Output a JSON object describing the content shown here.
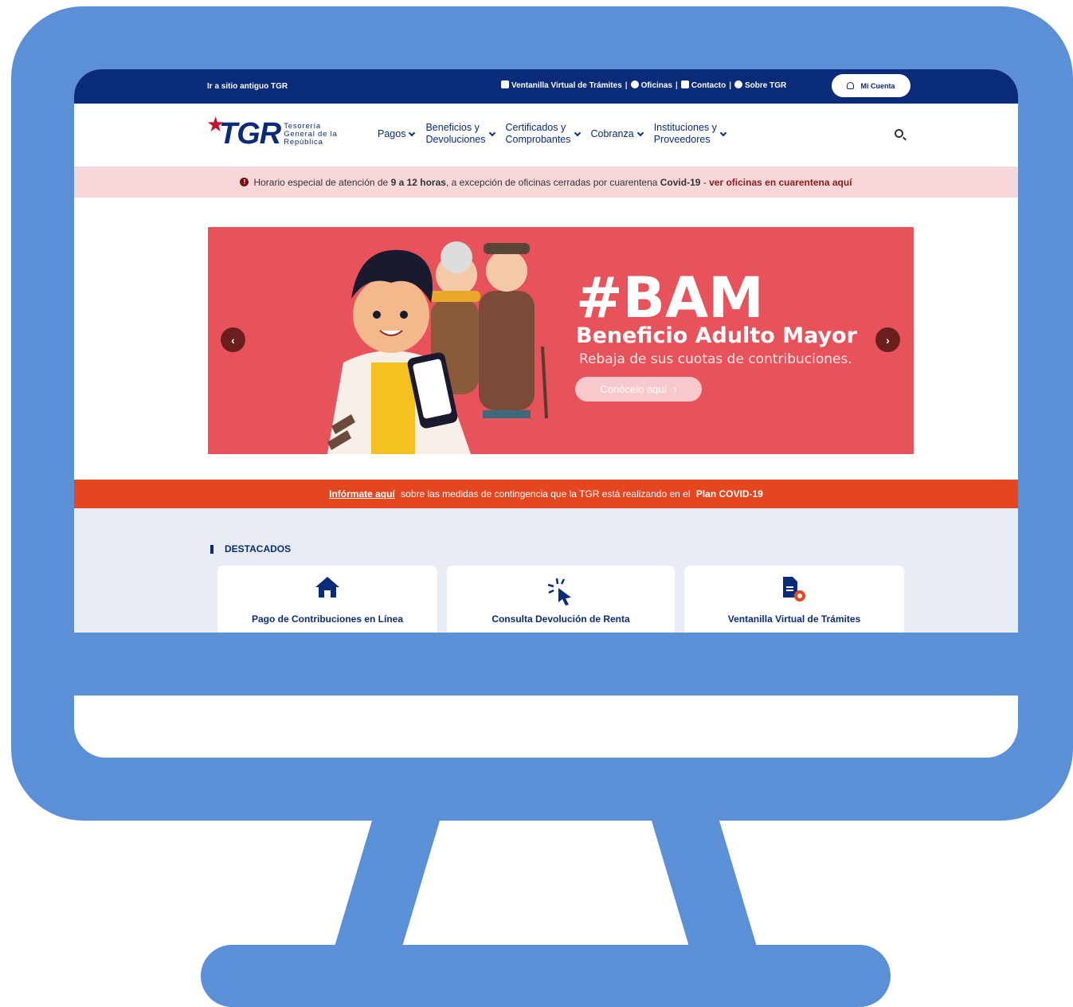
{
  "topbar": {
    "old_site": "Ir a sitio antiguo TGR",
    "links": [
      "Ventanilla Virtual de Trámites",
      "Oficinas",
      "Contacto",
      "Sobre TGR"
    ],
    "separator": "|",
    "account": "Mi Cuenta"
  },
  "logo": {
    "tgr": "TGR",
    "line1": "Tesorería",
    "line2": "General de la",
    "line3": "República"
  },
  "nav": {
    "items": [
      {
        "line1": "Pagos",
        "line2": ""
      },
      {
        "line1": "Beneficios y",
        "line2": "Devoluciones"
      },
      {
        "line1": "Certificados y",
        "line2": "Comprobantes"
      },
      {
        "line1": "Cobranza",
        "line2": ""
      },
      {
        "line1": "Instituciones y",
        "line2": "Proveedores"
      }
    ]
  },
  "alert": {
    "p1": "Horario especial de atención de ",
    "hours": "9 a 12 horas",
    "p2": ", a excepción de oficinas cerradas por cuarentena ",
    "covid": "Covid-19",
    "p3": " - ",
    "link": "ver oficinas en cuarentena aquí"
  },
  "banner": {
    "hashtag": "#BAM",
    "title": "Beneficio Adulto Mayor",
    "subtitle": "Rebaja de sus cuotas de contribuciones.",
    "cta": "Conócelo aquí",
    "prev": "‹",
    "next": "›"
  },
  "covid_bar": {
    "link": "Infórmate aquí",
    "text": " sobre las medidas de contingencia que la TGR está realizando en el ",
    "plan": "Plan COVID-19"
  },
  "destacados": {
    "title": "DESTACADOS",
    "cards": [
      {
        "label": "Pago de Contribuciones en Línea",
        "icon": "home-icon"
      },
      {
        "label": "Consulta Devolución de Renta",
        "icon": "cursor-click-icon"
      },
      {
        "label": "Ventanilla Virtual de Trámites",
        "icon": "document-virus-icon"
      }
    ]
  },
  "colors": {
    "navy": "#0a2a7a",
    "banner_red": "#e8525b",
    "covid_orange": "#e4461f",
    "monitor_blue": "#5b8fd6"
  }
}
